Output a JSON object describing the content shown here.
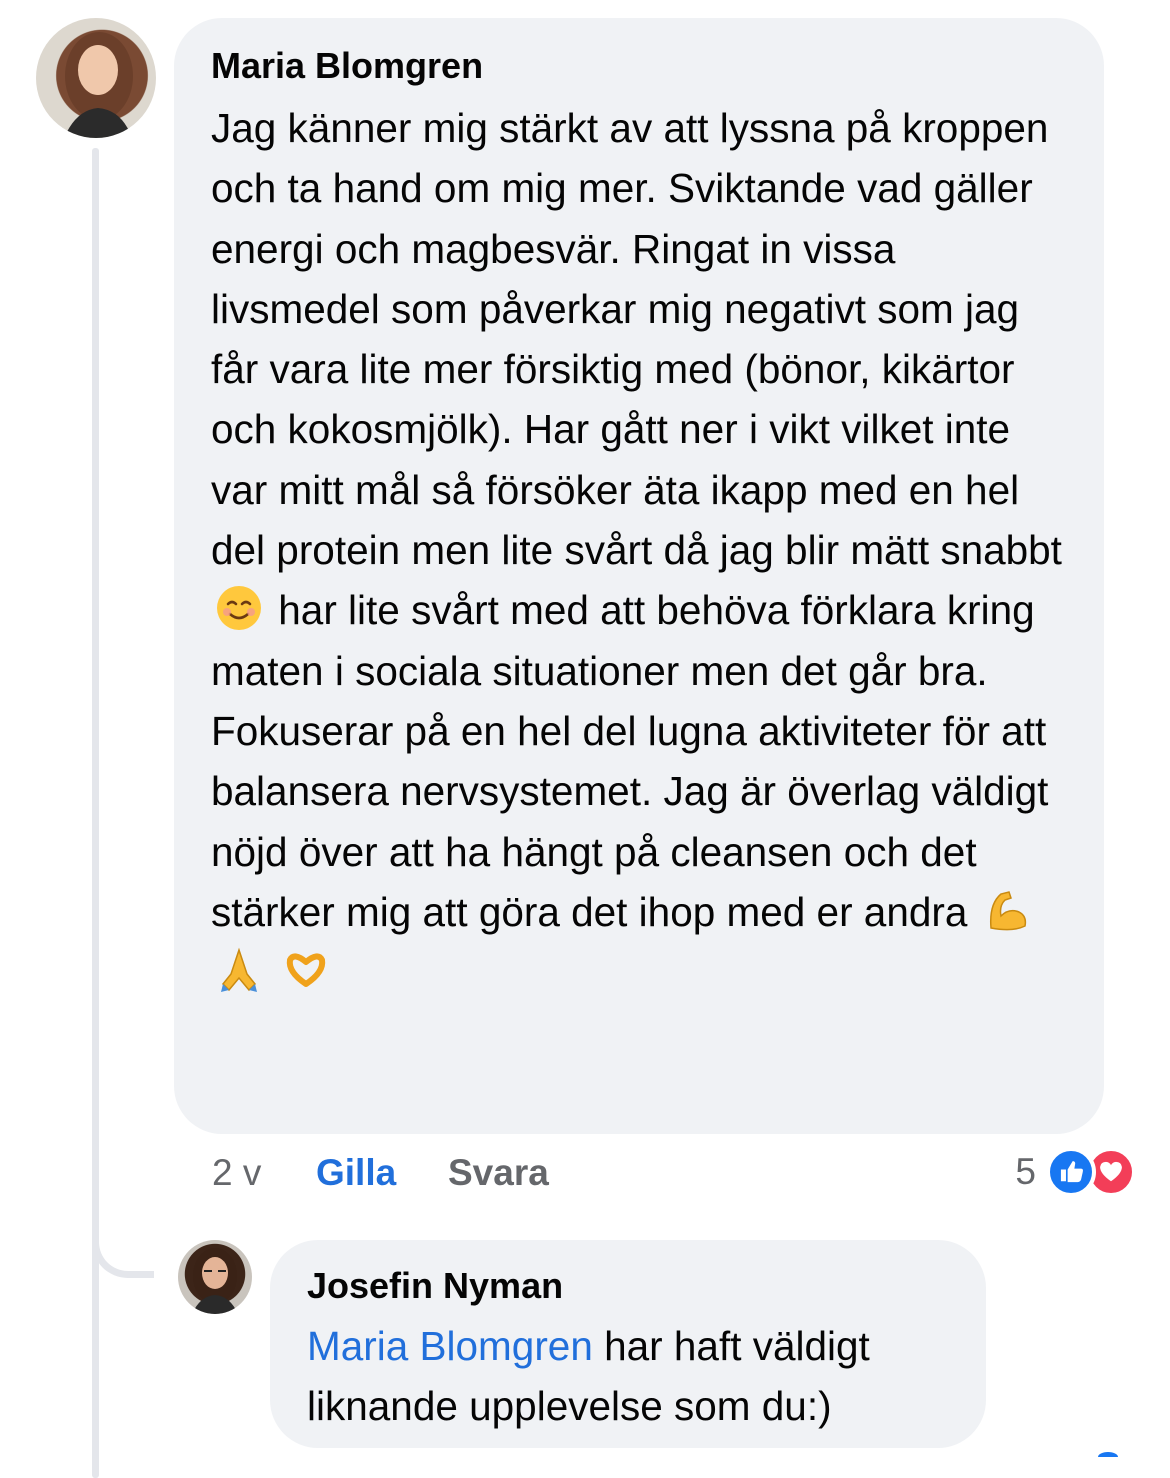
{
  "comment": {
    "author": "Maria Blomgren",
    "text_before_emoji": "Jag känner mig stärkt av att lyssna på kroppen och ta hand om mig mer. Sviktande vad gäller energi och magbesvär. Ringat in vissa livsmedel som påverkar mig negativt som jag får vara lite mer försiktig med (bönor, kikärtor och kokosmjölk). Har gått ner i vikt vilket inte var mitt mål så försöker äta ikapp med en hel del protein men lite svårt då jag blir mätt snabbt",
    "text_after_emoji": "har lite svårt med att behöva förklara kring maten i sociala situationer men det går bra. Fokuserar på en hel del lugna aktiviteter för att balansera nervsystemet. Jag är överlag väldigt nöjd över att ha hängt på cleansen och det stärker mig att göra det ihop med er andra",
    "inline_emoji": "smiling-face-emoji",
    "trailing_emojis": [
      "flexed-biceps-emoji",
      "folded-hands-emoji",
      "heart-hands-emoji"
    ],
    "time": "2 v",
    "like_label": "Gilla",
    "reply_label": "Svara",
    "reaction_count": "5",
    "reactions": [
      "like",
      "love"
    ]
  },
  "reply": {
    "author": "Josefin Nyman",
    "mention": "Maria Blomgren",
    "text": " har haft väldigt liknande upplevelse som du:)"
  },
  "colors": {
    "bubble": "#f0f2f5",
    "link": "#216fdb",
    "meta": "#65676b",
    "like_reaction": "#1877f2",
    "love_reaction": "#f33e58"
  }
}
